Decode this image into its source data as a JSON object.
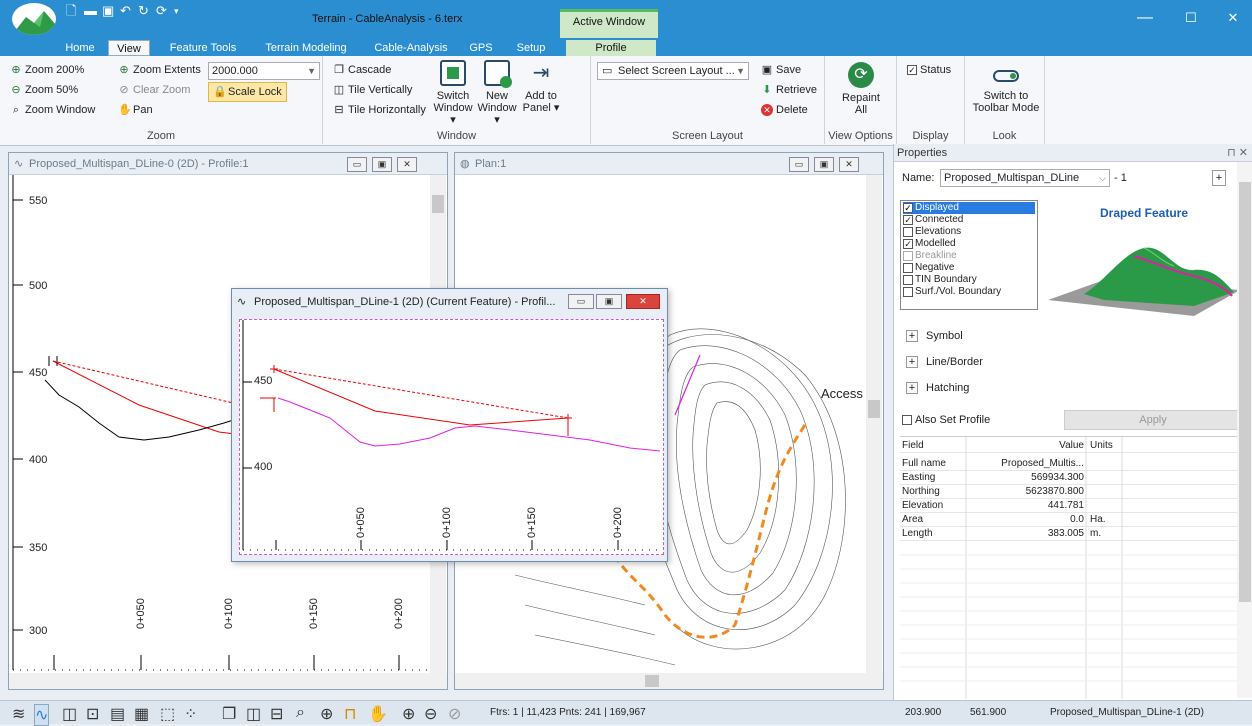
{
  "app": {
    "title": "Terrain - CableAnalysis - 6.terx",
    "context_tab": "Active Window",
    "min": "—",
    "max": "☐",
    "close": "✕"
  },
  "tabs": [
    "Home",
    "View",
    "Feature Tools",
    "Terrain Modeling",
    "Cable-Analysis",
    "GPS",
    "Setup",
    "Profile"
  ],
  "ribbon": {
    "zoom": {
      "zoom200": "Zoom 200%",
      "zoom50": "Zoom 50%",
      "zoom_window": "Zoom Window",
      "zoom_extents": "Zoom Extents",
      "clear_zoom": "Clear Zoom",
      "pan": "Pan",
      "scale_value": "2000.000",
      "scale_lock": "Scale Lock",
      "label": "Zoom"
    },
    "window": {
      "cascade": "Cascade",
      "tile_v": "Tile Vertically",
      "tile_h": "Tile Horizontally",
      "switch": "Switch",
      "switch2": "Window ▾",
      "new": "New",
      "new2": "Window ▾",
      "add": "Add to",
      "add2": "Panel ▾",
      "label": "Window"
    },
    "screen_layout": {
      "select": "Select Screen Layout ...",
      "save": "Save",
      "retrieve": "Retrieve",
      "delete": "Delete",
      "label": "Screen Layout"
    },
    "view_options": {
      "repaint": "Repaint",
      "repaint2": "All",
      "label": "View Options"
    },
    "display": {
      "status": "Status",
      "label": "Display"
    },
    "look": {
      "switch": "Switch to",
      "switch2": "Toolbar Mode",
      "label": "Look"
    }
  },
  "profile_pane": {
    "title": "Proposed_Multispan_DLine-0 (2D) - Profile:1",
    "y_ticks": [
      "550",
      "500",
      "450",
      "400",
      "350",
      "300"
    ],
    "x_ticks": [
      "0+050",
      "0+100",
      "0+150",
      "0+200"
    ]
  },
  "plan_pane": {
    "title": "Plan:1",
    "label": "Access"
  },
  "float_window": {
    "title": "Proposed_Multispan_DLine-1 (2D) (Current Feature) - Profil...",
    "y_ticks": [
      "450",
      "400"
    ],
    "x_ticks": [
      "0+050",
      "0+100",
      "0+150",
      "0+200"
    ]
  },
  "properties": {
    "header": "Properties",
    "pin": "⊓ ✕",
    "name_label": "Name:",
    "name_value": "Proposed_Multispan_DLine",
    "name_index": "- 1",
    "flags": [
      {
        "label": "Displayed",
        "checked": true
      },
      {
        "label": "Connected",
        "checked": true
      },
      {
        "label": "Elevations",
        "checked": false
      },
      {
        "label": "Modelled",
        "checked": true
      },
      {
        "label": "Breakline",
        "checked": false
      },
      {
        "label": "Negative",
        "checked": false
      },
      {
        "label": "TIN Boundary",
        "checked": false
      },
      {
        "label": "Surf./Vol. Boundary",
        "checked": false
      }
    ],
    "preview_title": "Draped Feature",
    "sections": [
      "Symbol",
      "Line/Border",
      "Hatching"
    ],
    "also_set_profile": "Also Set Profile",
    "apply": "Apply",
    "table_headers": {
      "field": "Field",
      "value": "Value",
      "units": "Units"
    },
    "rows": [
      {
        "field": "Full name",
        "value": "Proposed_Multis...",
        "units": ""
      },
      {
        "field": "Easting",
        "value": "569934.300",
        "units": ""
      },
      {
        "field": "Northing",
        "value": "5623870.800",
        "units": ""
      },
      {
        "field": "Elevation",
        "value": "441.781",
        "units": ""
      },
      {
        "field": "Area",
        "value": "0.0",
        "units": "Ha."
      },
      {
        "field": "Length",
        "value": "383.005",
        "units": "m."
      }
    ]
  },
  "statusbar": {
    "counts": "Ftrs: 1 | 11,423  Pnts: 241 | 169,967",
    "x": "203.900",
    "y": "561.900",
    "feature": "Proposed_Multispan_DLine-1 (2D)"
  }
}
